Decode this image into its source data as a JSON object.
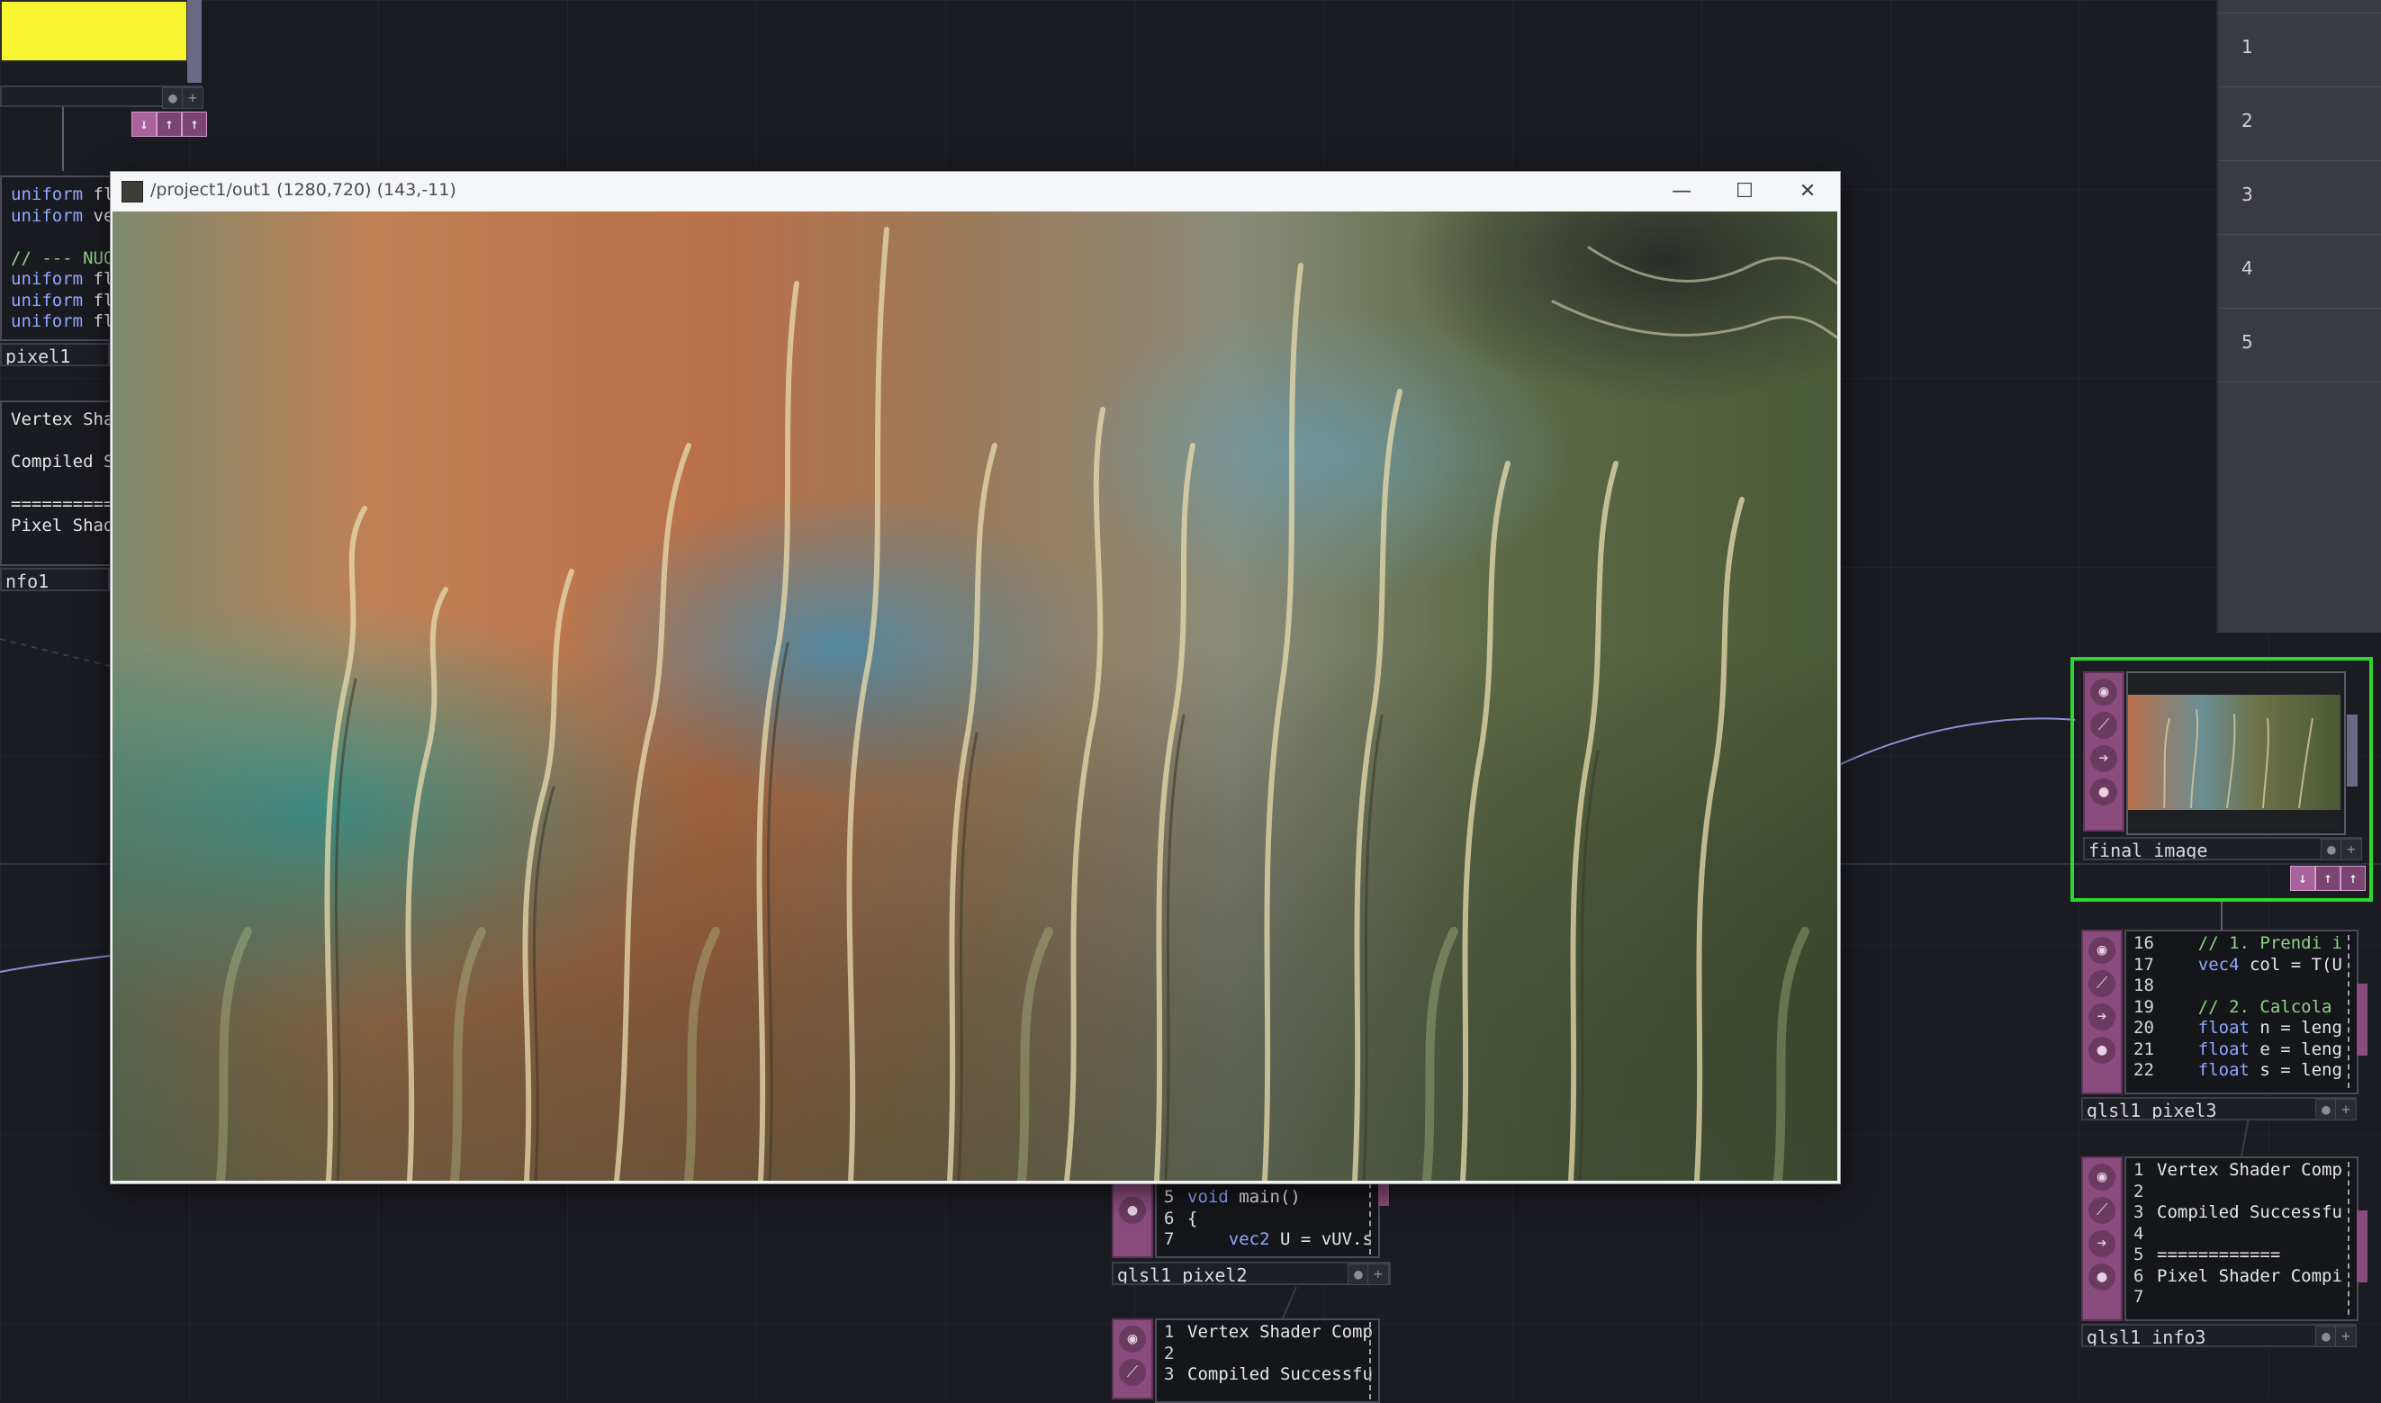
{
  "window": {
    "title": "/project1/out1 (1280,720) (143,-11)",
    "minimize": "—",
    "maximize": "☐",
    "close": "✕"
  },
  "right_panel": {
    "rows": [
      "1",
      "2",
      "3",
      "4",
      "5"
    ]
  },
  "left_code_lines": [
    "uniform fl",
    "uniform ve",
    "",
    "// --- NUO",
    "uniform fl",
    "uniform fl",
    "uniform fl"
  ],
  "left_pixel_label": "pixel1",
  "left_info_lines": [
    "Vertex Sha",
    "",
    "Compiled S",
    "",
    "==========",
    "Pixel Shad"
  ],
  "left_info_label": "nfo1",
  "final_image": {
    "label": "final_image"
  },
  "pixel3": {
    "label": "glsl1_pixel3",
    "lines": [
      {
        "n": "16",
        "t": "    // 1. Prendi i"
      },
      {
        "n": "17",
        "t": "    vec4 col = T(U"
      },
      {
        "n": "18",
        "t": ""
      },
      {
        "n": "19",
        "t": "    // 2. Calcola"
      },
      {
        "n": "20",
        "t": "    float n = leng"
      },
      {
        "n": "21",
        "t": "    float e = leng"
      },
      {
        "n": "22",
        "t": "    float s = leng"
      }
    ]
  },
  "info3": {
    "label": "glsl1_info3",
    "lines": [
      {
        "n": "1",
        "t": "Vertex Shader Comp"
      },
      {
        "n": "2",
        "t": ""
      },
      {
        "n": "3",
        "t": "Compiled Successfu"
      },
      {
        "n": "4",
        "t": ""
      },
      {
        "n": "5",
        "t": "============"
      },
      {
        "n": "6",
        "t": "Pixel Shader Compi"
      },
      {
        "n": "7",
        "t": ""
      }
    ]
  },
  "pixel2": {
    "label": "glsl1_pixel2",
    "lines": [
      {
        "n": "5",
        "t": "void main()"
      },
      {
        "n": "6",
        "t": "{"
      },
      {
        "n": "7",
        "t": "    vec2 U = vUV.s"
      }
    ]
  },
  "info2": {
    "lines": [
      {
        "n": "1",
        "t": "Vertex Shader Comp"
      },
      {
        "n": "2",
        "t": ""
      },
      {
        "n": "3",
        "t": "Compiled Successfu"
      }
    ]
  }
}
